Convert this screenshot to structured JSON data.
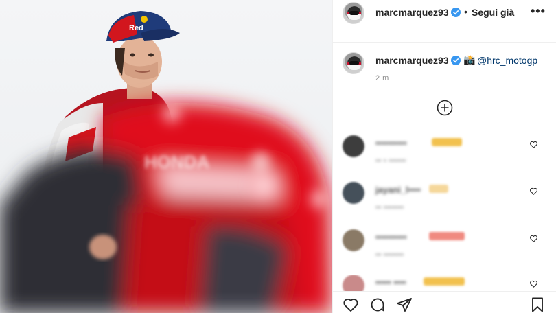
{
  "post": {
    "username": "marcmarquez93",
    "follow_status": "Segui già",
    "more_label": "•••",
    "caption_mention": "@hrc_motogp",
    "caption_emoji": "📸",
    "time_ago": "2 m"
  },
  "comments": [
    {
      "name": "••••••••••",
      "meta": "•• • ••••••",
      "avatar_color": "#3d3d3d",
      "emoji_color": "#f2c14e"
    },
    {
      "name": "jayani_l••••",
      "meta": "•• •••••••",
      "avatar_color": "#45505a",
      "emoji_color": "#f5d79a"
    },
    {
      "name": "••••••••••",
      "meta": "•• •••••••",
      "avatar_color": "#8a7a66",
      "emoji_color": "#f08a80"
    },
    {
      "name": "••••• ••••",
      "meta": "",
      "avatar_color": "#c98a8a",
      "emoji_color": "#f2c14e"
    }
  ],
  "icons": {
    "more": "more-options-icon",
    "verified": "verified-badge-icon",
    "load_more": "plus-circle-icon",
    "like": "heart-icon",
    "comment": "comment-icon",
    "share": "share-icon",
    "save": "bookmark-icon"
  },
  "colors": {
    "verified_blue": "#3897f0",
    "mention_blue": "#00376b",
    "honda_red": "#d2161e"
  }
}
